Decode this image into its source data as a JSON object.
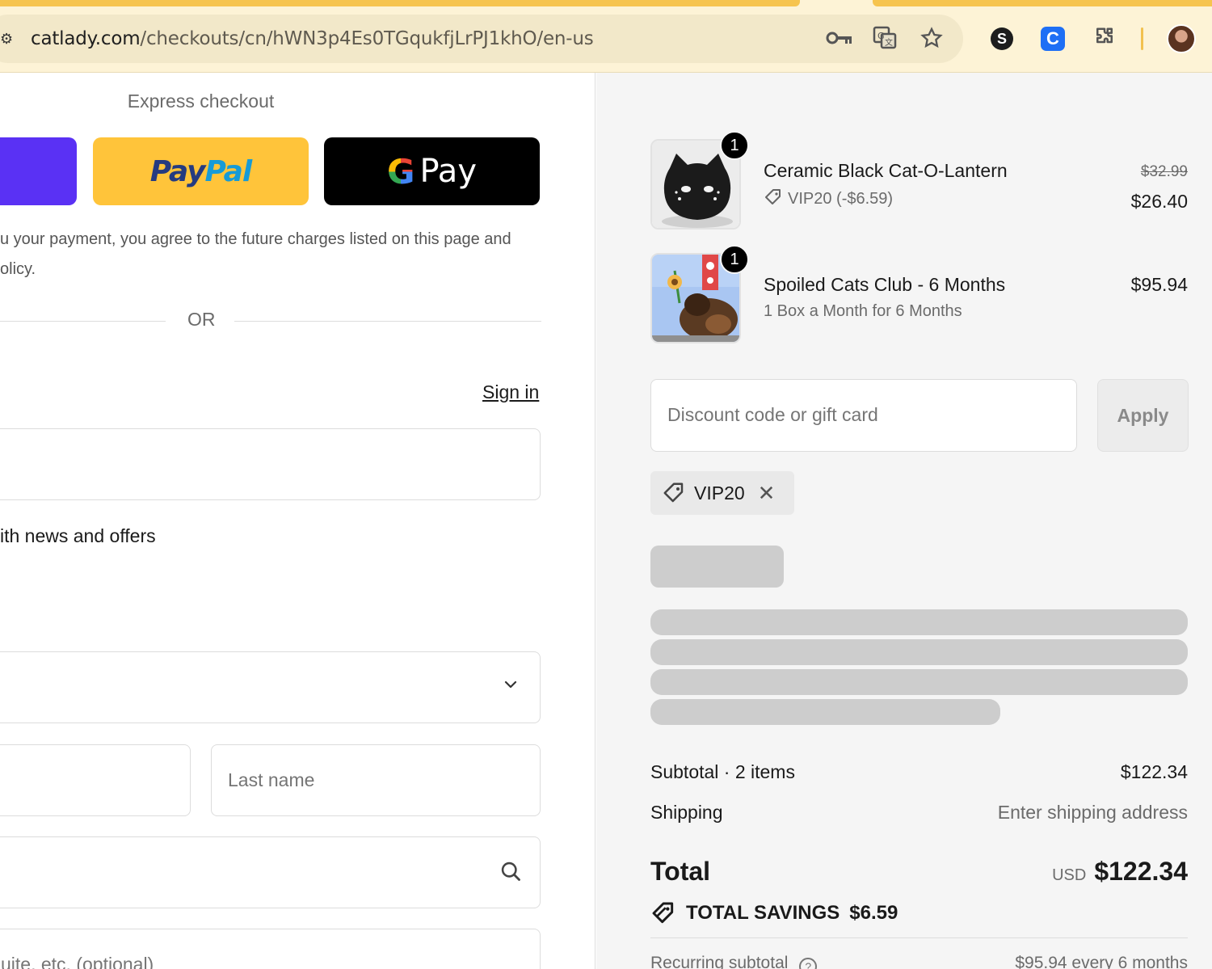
{
  "browser": {
    "url_domain": "catlady.com",
    "url_path": "/checkouts/cn/hWN3p4Es0TGqukfjLrPJ1khO/en-us",
    "icons": [
      "site-info-icon",
      "password-key-icon",
      "translate-icon",
      "bookmark-star-icon",
      "extension-s-icon",
      "extension-c-icon",
      "extensions-puzzle-icon",
      "profile-avatar"
    ],
    "ext_s_letter": "S",
    "ext_c_letter": "C"
  },
  "checkout": {
    "express_label": "Express checkout",
    "paypal_part1": "Pay",
    "paypal_part2": "Pal",
    "gpay_g": "G",
    "gpay_label": "Pay",
    "consent_line1": "u your payment, you agree to the future charges listed on this page and",
    "consent_line2": "olicy.",
    "or_label": "OR",
    "signin_label": "Sign in",
    "newsletter_label": "ith news and offers",
    "lastname_placeholder": "Last name",
    "apartment_placeholder": "uite, etc. (optional)"
  },
  "summary": {
    "items": [
      {
        "qty": "1",
        "title": "Ceramic Black Cat-O-Lantern",
        "discount": "VIP20 (-$6.59)",
        "old_price": "$32.99",
        "price": "$26.40"
      },
      {
        "qty": "1",
        "title": "Spoiled Cats Club - 6 Months",
        "subtitle": "1 Box a Month for 6 Months",
        "price": "$95.94"
      }
    ],
    "discount_placeholder": "Discount code or gift card",
    "apply_label": "Apply",
    "applied_code": "VIP20",
    "subtotal_label": "Subtotal · 2 items",
    "subtotal_value": "$122.34",
    "shipping_label": "Shipping",
    "shipping_value": "Enter shipping address",
    "total_label": "Total",
    "total_currency": "USD",
    "total_value": "$122.34",
    "savings_label": "TOTAL SAVINGS",
    "savings_value": "$6.59",
    "recurring_label": "Recurring subtotal",
    "recurring_value": "$95.94 every 6 months"
  },
  "colors": {
    "accent_paypal": "#ffc43a",
    "accent_shop": "#5a31f4",
    "gpay_bg": "#000000",
    "tab_yellow": "#f6c44f",
    "summary_bg": "#f5f5f5"
  }
}
